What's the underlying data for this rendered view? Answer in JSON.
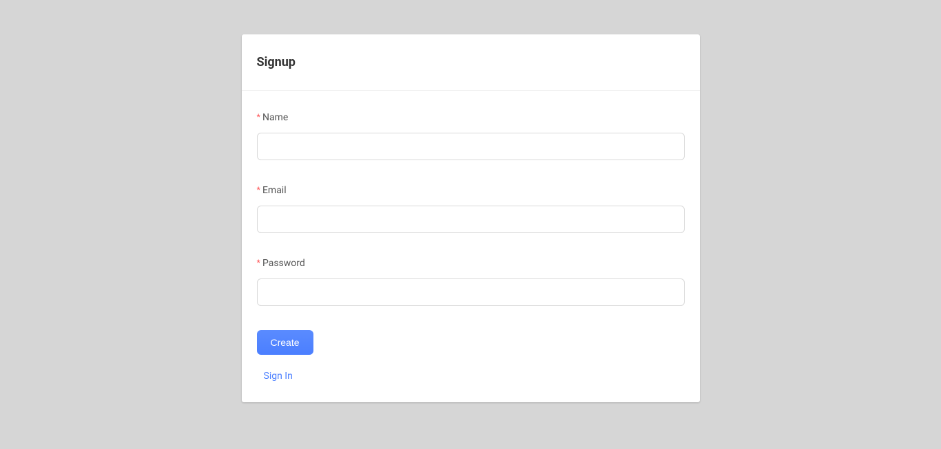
{
  "card": {
    "title": "Signup"
  },
  "form": {
    "name": {
      "label": "Name",
      "value": ""
    },
    "email": {
      "label": "Email",
      "value": ""
    },
    "password": {
      "label": "Password",
      "value": ""
    },
    "required_marker": "*",
    "submit_label": "Create",
    "signin_link_label": "Sign In"
  }
}
